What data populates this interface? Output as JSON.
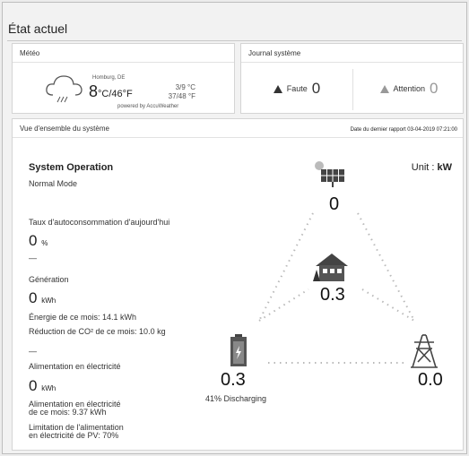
{
  "page": {
    "title": "État actuel"
  },
  "weather": {
    "header": "Météo",
    "location": "Homburg, DE",
    "temperature": "8",
    "unit": "°C/46°F",
    "minmax_c": "3/9 °C",
    "minmax_f": "37/48 °F",
    "powered_by": "powered by AccuWeather",
    "icon": "cloud-rain-icon"
  },
  "journal": {
    "header": "Journal système",
    "fault_label": "Faute",
    "fault_count": "0",
    "warning_label": "Attention",
    "warning_count": "0"
  },
  "overview": {
    "header": "Vue d'ensemble du système",
    "last_report": "Date du dernier rapport 03-04-2019 07:21:00",
    "operation_title": "System Operation",
    "operation_mode": "Normal Mode",
    "unit_label": "Unit : ",
    "unit_value": "kW",
    "self_consumption_label": "Taux d'autoconsommation d'aujourd'hui",
    "self_consumption_value": "0",
    "self_consumption_unit": "%",
    "dash1": "—",
    "generation_label": "Génération",
    "generation_value": "0",
    "generation_unit": "kWh",
    "energy_month": "Énergie de ce mois: 14.1 kWh",
    "co2_month": "Réduction de CO² de ce mois: 10.0 kg",
    "dash2": "—",
    "supply_label": "Alimentation en électricité",
    "supply_value": "0",
    "supply_unit": "kWh",
    "supply_month_l1": "Alimentation en électricité",
    "supply_month_l2": "de ce mois: 9.37 kWh",
    "limit_l1": "Limitation de l'alimentation",
    "limit_l2": "en électricité de PV: 70%",
    "pv_value": "0",
    "home_value": "0.3",
    "battery_value": "0.3",
    "battery_status": "41% Discharging",
    "grid_value": "0.0"
  },
  "colors": {
    "panel": "#ffffff",
    "border": "#d4d4d4",
    "dots": "#b9b9b9",
    "icon": "#555555"
  }
}
